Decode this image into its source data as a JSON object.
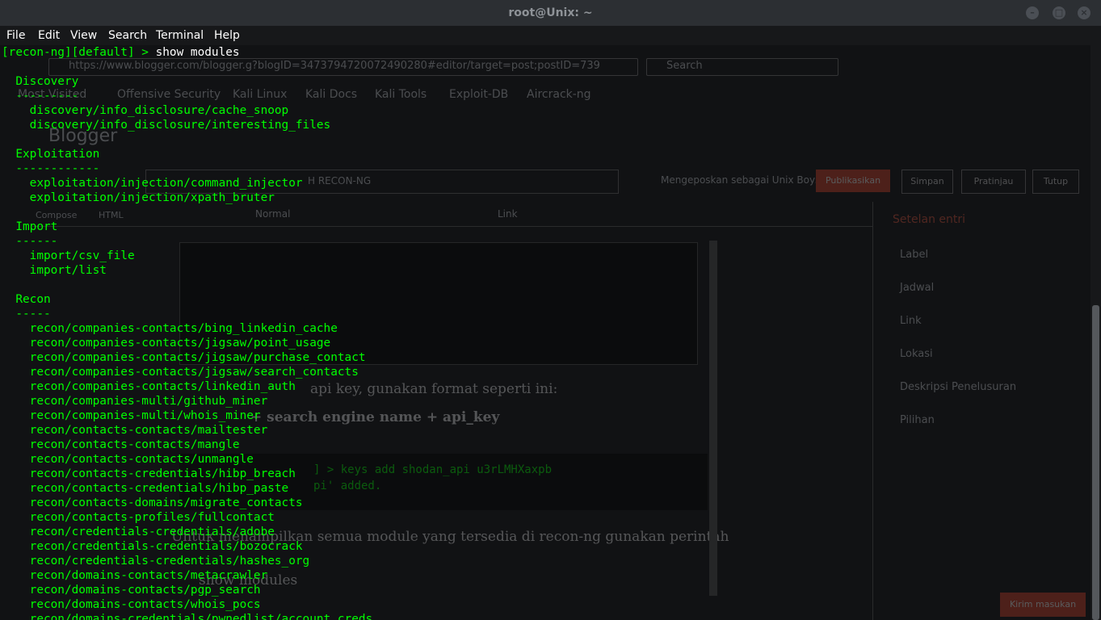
{
  "window": {
    "title": "root@Unix: ~"
  },
  "menu": [
    "File",
    "Edit",
    "View",
    "Search",
    "Terminal",
    "Help"
  ],
  "terminal": {
    "prompt": "[recon-ng][default] > ",
    "command": "show modules",
    "lines": [
      "",
      "  Discovery",
      "  ---------",
      "    discovery/info_disclosure/cache_snoop",
      "    discovery/info_disclosure/interesting_files",
      "",
      "  Exploitation",
      "  ------------",
      "    exploitation/injection/command_injector",
      "    exploitation/injection/xpath_bruter",
      "",
      "  Import",
      "  ------",
      "    import/csv_file",
      "    import/list",
      "",
      "  Recon",
      "  -----",
      "    recon/companies-contacts/bing_linkedin_cache",
      "    recon/companies-contacts/jigsaw/point_usage",
      "    recon/companies-contacts/jigsaw/purchase_contact",
      "    recon/companies-contacts/jigsaw/search_contacts",
      "    recon/companies-contacts/linkedin_auth",
      "    recon/companies-multi/github_miner",
      "    recon/companies-multi/whois_miner",
      "    recon/contacts-contacts/mailtester",
      "    recon/contacts-contacts/mangle",
      "    recon/contacts-contacts/unmangle",
      "    recon/contacts-credentials/hibp_breach",
      "    recon/contacts-credentials/hibp_paste",
      "    recon/contacts-domains/migrate_contacts",
      "    recon/contacts-profiles/fullcontact",
      "    recon/credentials-credentials/adobe",
      "    recon/credentials-credentials/bozocrack",
      "    recon/credentials-credentials/hashes_org",
      "    recon/domains-contacts/metacrawler",
      "    recon/domains-contacts/pgp_search",
      "    recon/domains-contacts/whois_pocs",
      "    recon/domains-credentials/pwnedlist/account_creds"
    ]
  },
  "background": {
    "url": "https://www.blogger.com/blogger.g?blogID=3473794720072490280#editor/target=post;postID=739",
    "search_placeholder": "Search",
    "bookmarks": [
      "Most Visited",
      "Offensive Security",
      "Kali Linux",
      "Kali Docs",
      "Kali Tools",
      "Exploit-DB",
      "Aircrack-ng"
    ],
    "app_name": "Blogger",
    "post_title": "H RECON-NG",
    "posting_as": "Mengeposkan sebagai Unix Boys",
    "buttons": [
      "Publikasikan",
      "Simpan",
      "Pratinjau",
      "Tutup"
    ],
    "tabs": [
      "Compose",
      "HTML"
    ],
    "format_select": "Normal",
    "link_button": "Link",
    "sidebar_title": "Setelan entri",
    "sidebar_items": [
      "Label",
      "Jadwal",
      "Link",
      "Lokasi",
      "Deskripsi Penelusuran",
      "Pilihan"
    ],
    "body_lines": [
      "api key, gunakan format seperti ini:",
      "+ search engine name + api_key",
      "Untuk menampilkan semua module yang tersedia di recon-ng gunakan perintah",
      "show modules"
    ],
    "code_lines": [
      "] > keys add shodan_api u3rLMHXaxpb",
      "pi' added."
    ],
    "send_feedback": "Kirim masukan"
  }
}
